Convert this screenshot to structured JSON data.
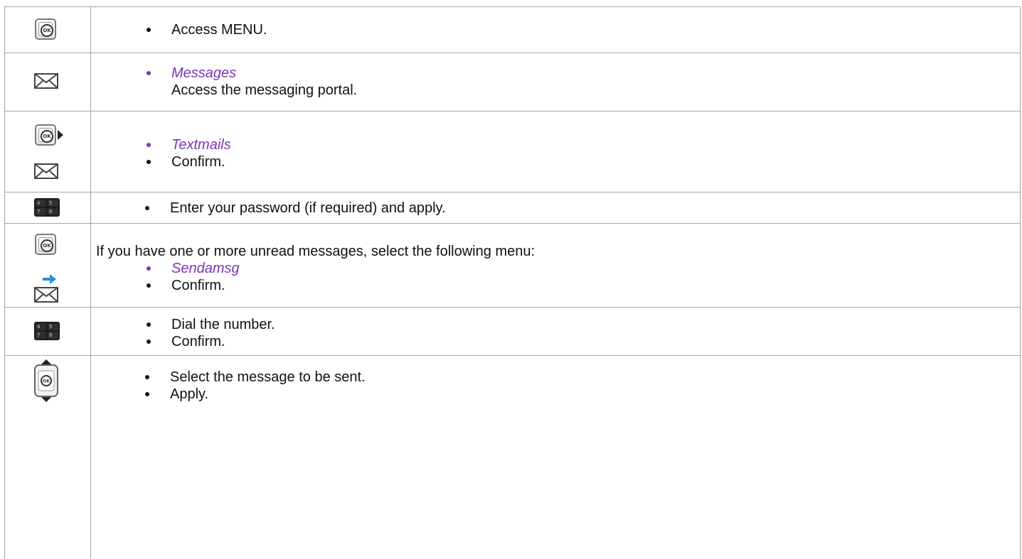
{
  "rows": [
    {
      "icons": [
        "ok-key-icon"
      ],
      "lines": [
        "Access MENU."
      ]
    },
    {
      "icons": [
        "envelope-icon"
      ],
      "lines": [
        "Messages",
        "Access the messaging portal."
      ]
    },
    {
      "icons": [
        "ok-key-right-icon",
        "envelope-icon"
      ],
      "lines": [
        "Textmails",
        "Confirm."
      ]
    },
    {
      "icons": [
        "keypad-icon"
      ],
      "lines": [
        "Enter your password (if required) and apply."
      ]
    },
    {
      "icons": [
        "ok-key-icon",
        "envelope-send-icon"
      ],
      "lines": [
        "If you have one or more unread messages, select the following menu:",
        "Sendamsg",
        "Confirm."
      ]
    },
    {
      "icons": [
        "keypad-icon"
      ],
      "lines": [
        "Dial the number.",
        "Confirm."
      ]
    },
    {
      "icons": [
        "ok-key-up-down-icon"
      ],
      "lines": [
        "Select the message to be sent.",
        "Apply."
      ]
    }
  ],
  "keypad_digits": [
    "4",
    "5",
    "7",
    "8"
  ],
  "ok_key_label": "OK",
  "colors": {
    "menu_item": "#7a35b5",
    "border": "#a6a6a6",
    "text": "#111111"
  }
}
